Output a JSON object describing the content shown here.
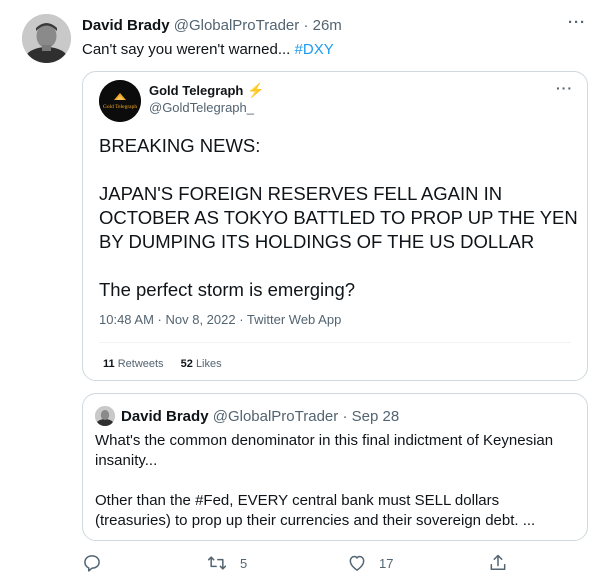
{
  "tweet": {
    "author_name": "David Brady",
    "handle": "@GlobalProTrader",
    "separator": "·",
    "time": "26m",
    "more": "···",
    "text": "Can't say you weren't warned...",
    "hashtag": "#DXY"
  },
  "quoted": {
    "author_name": "Gold Telegraph",
    "badge_icon": "lightning-bolt-icon",
    "handle": "@GoldTelegraph_",
    "avatar_logo_text": "Gold Telegraph",
    "more": "···",
    "line1": "BREAKING NEWS:",
    "line2": "JAPAN'S FOREIGN RESERVES FELL AGAIN IN",
    "line3": "OCTOBER AS TOKYO BATTLED TO PROP UP THE YEN",
    "line4": "BY DUMPING ITS HOLDINGS OF THE US DOLLAR",
    "line5": "The perfect storm is emerging?",
    "timestamp": "10:48 AM · Nov 8, 2022 · Twitter Web App",
    "retweets_count": "11",
    "retweets_label": "Retweets",
    "likes_count": "52",
    "likes_label": "Likes"
  },
  "nested": {
    "author_name": "David Brady",
    "handle": "@GlobalProTrader",
    "separator": "·",
    "time": "Sep 28",
    "line1": "What's the common denominator in this final indictment of Keynesian",
    "line2": "insanity...",
    "line3": "Other than the #Fed, EVERY central bank must SELL dollars",
    "line4": "(treasuries) to prop up their currencies and their sovereign debt. ..."
  },
  "actions": {
    "reply_icon": "reply-icon",
    "retweet_icon": "retweet-icon",
    "retweet_count": "5",
    "like_icon": "heart-icon",
    "like_count": "17",
    "share_icon": "share-icon"
  },
  "colors": {
    "link": "#1d9bf0",
    "muted": "#536471",
    "border": "#cfd9de",
    "bolt": "#f5a623"
  }
}
